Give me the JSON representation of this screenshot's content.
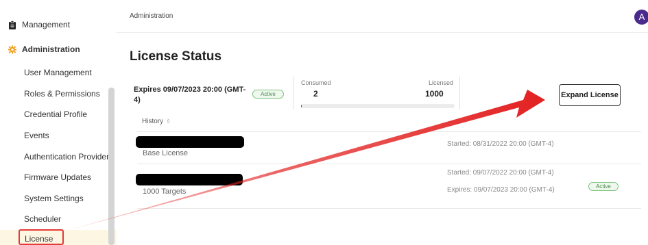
{
  "sidebar": {
    "management": "Management",
    "administration": "Administration",
    "items": [
      "User Management",
      "Roles & Permissions",
      "Credential Profile",
      "Events",
      "Authentication Providers",
      "Firmware Updates",
      "System Settings",
      "Scheduler"
    ],
    "license": "License"
  },
  "header": {
    "breadcrumb": "Administration",
    "avatar_initial": "A"
  },
  "page": {
    "title": "License Status"
  },
  "summary": {
    "expires": "Expires 09/07/2023 20:00 (GMT-4)",
    "status_badge": "Active",
    "consumed_label": "Consumed",
    "consumed_value": "2",
    "licensed_label": "Licensed",
    "licensed_value": "1000",
    "usage_fraction": 0.002,
    "expand_button": "Expand License"
  },
  "history": {
    "header": "History",
    "rows": [
      {
        "subtitle": "Base License",
        "started": "Started: 08/31/2022 20:00 (GMT-4)"
      },
      {
        "subtitle": "1000 Targets",
        "started": "Started: 09/07/2022 20:00 (GMT-4)",
        "expires": "Expires: 09/07/2023 20:00 (GMT-4)",
        "status_badge": "Active"
      }
    ]
  },
  "colors": {
    "accent": "#4a2a8c",
    "admin_icon": "#f0a020",
    "highlight_box": "#e53935",
    "arrow": "#e32222",
    "active_badge": "#7cc47c"
  }
}
